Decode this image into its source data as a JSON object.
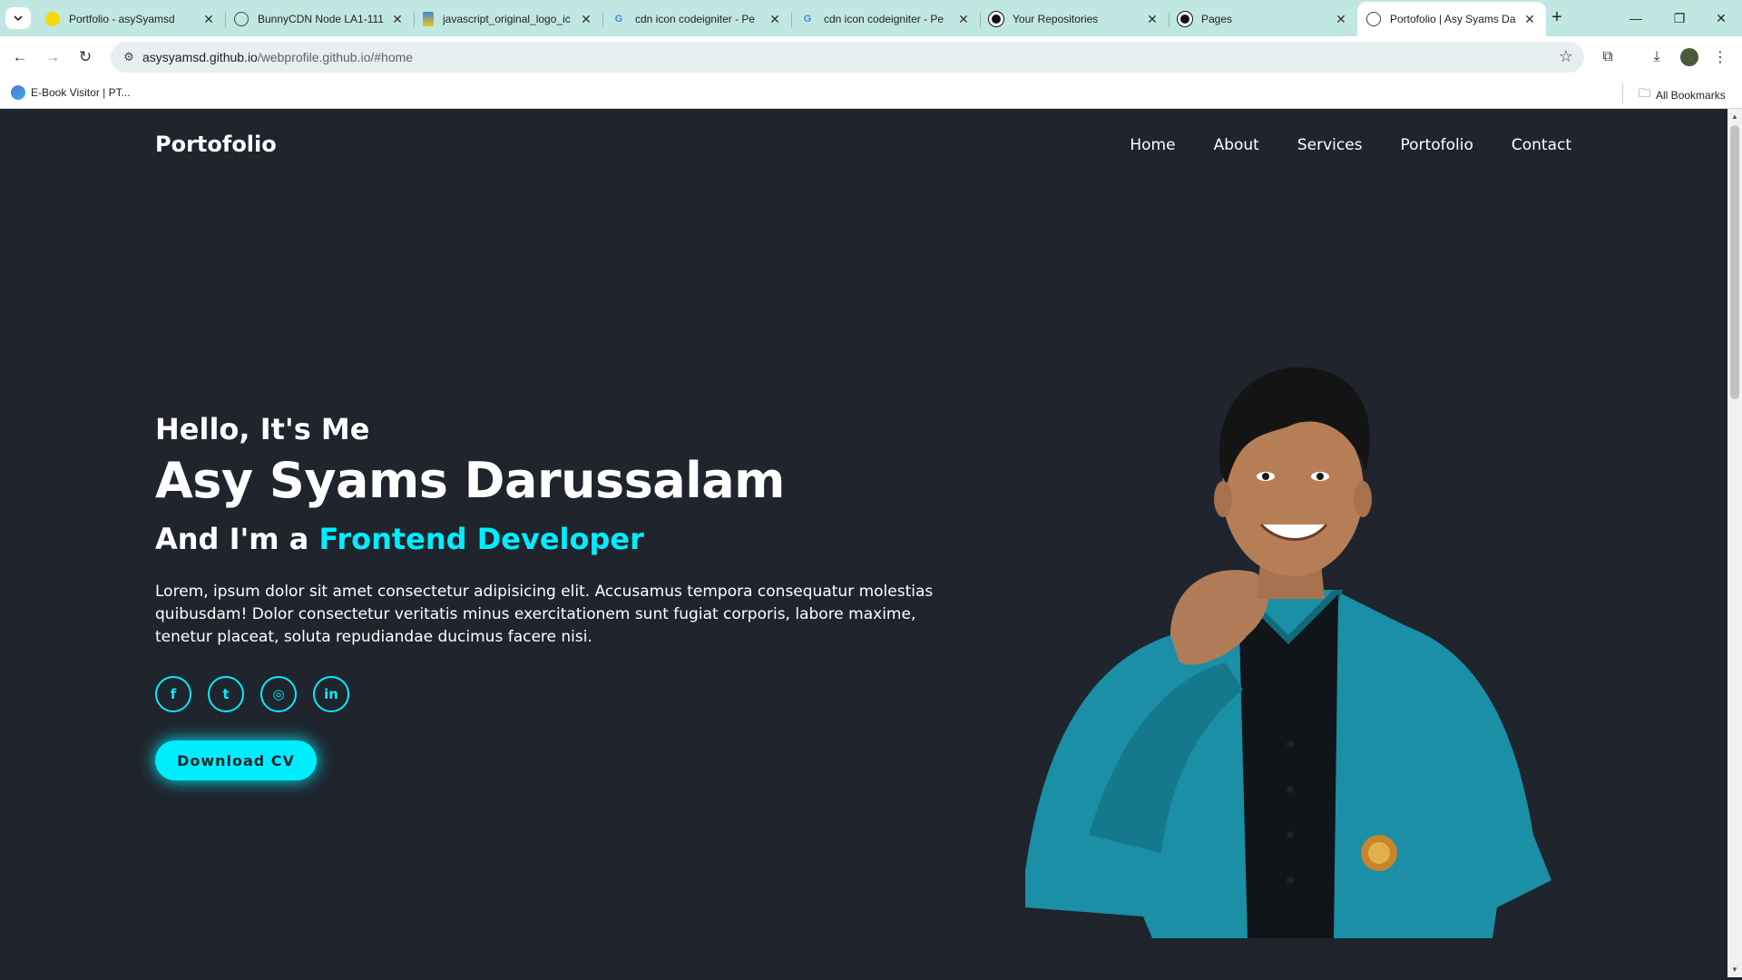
{
  "browser": {
    "tabs": [
      {
        "title": "Portfolio - asySyamsd",
        "favicon": "yellow-circle-icon",
        "fav_color": "#f5d90a"
      },
      {
        "title": "BunnyCDN Node LA1-111",
        "favicon": "globe-icon",
        "fav_color": "#ffffff"
      },
      {
        "title": "javascript_original_logo_ic",
        "favicon": "image-icon",
        "fav_color": "#ffffff"
      },
      {
        "title": "cdn icon codeigniter - Pe",
        "favicon": "google-icon",
        "fav_color": "#ffffff"
      },
      {
        "title": "cdn icon codeigniter - Pe",
        "favicon": "google-icon",
        "fav_color": "#ffffff"
      },
      {
        "title": "Your Repositories",
        "favicon": "github-icon",
        "fav_color": "#ffffff"
      },
      {
        "title": "Pages",
        "favicon": "github-icon",
        "fav_color": "#ffffff"
      },
      {
        "title": "Portofolio | Asy Syams Da",
        "favicon": "globe-icon",
        "fav_color": "#ffffff"
      }
    ],
    "active_tab": 7,
    "url_host": "asysyamsd.github.io",
    "url_path": "/webprofile.github.io/#home",
    "bookmarks": [
      {
        "label": "E-Book Visitor | PT..."
      }
    ],
    "all_bookmarks_label": "All Bookmarks"
  },
  "site": {
    "logo": "Portofolio",
    "nav": [
      {
        "label": "Home"
      },
      {
        "label": "About"
      },
      {
        "label": "Services"
      },
      {
        "label": "Portofolio"
      },
      {
        "label": "Contact"
      }
    ],
    "hero": {
      "greeting": "Hello, It's Me",
      "name": "Asy Syams Darussalam",
      "role_prefix": "And I'm a ",
      "role": "Frontend Developer",
      "description": "Lorem, ipsum dolor sit amet consectetur adipisicing elit. Accusamus tempora consequatur molestias quibusdam! Dolor consectetur veritatis minus exercitationem sunt fugiat corporis, labore maxime, tenetur placeat, soluta repudiandae ducimus facere nisi.",
      "socials": [
        {
          "icon": "facebook-icon",
          "glyph": "f"
        },
        {
          "icon": "twitter-icon",
          "glyph": "t"
        },
        {
          "icon": "instagram-icon",
          "glyph": "◎"
        },
        {
          "icon": "linkedin-icon",
          "glyph": "in"
        }
      ],
      "cta": "Download CV"
    },
    "colors": {
      "background": "#1f242d",
      "accent": "#00eeff",
      "text": "#ffffff"
    }
  }
}
